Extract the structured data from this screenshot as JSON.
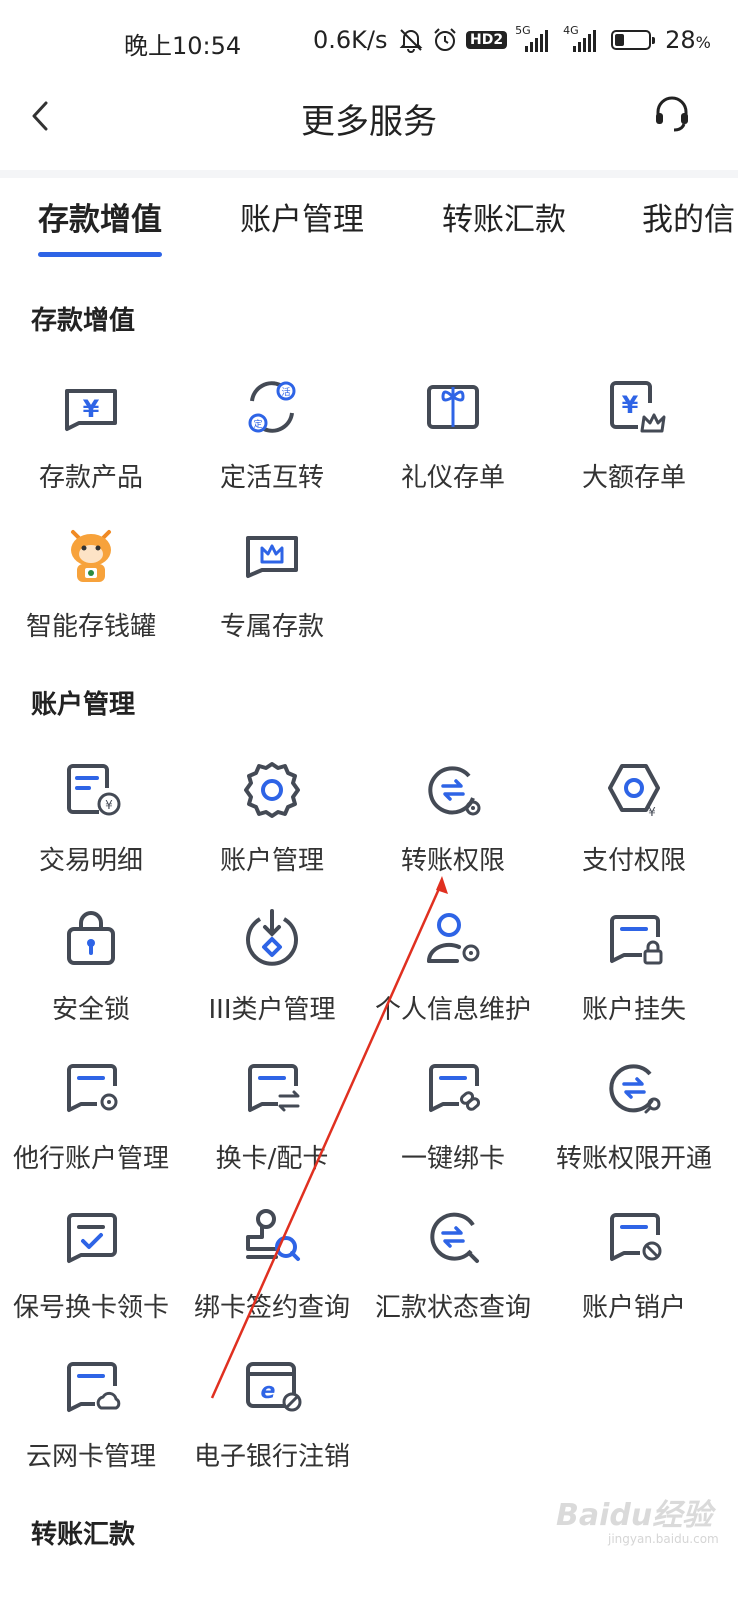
{
  "status": {
    "time": "晚上10:54",
    "speed": "0.6K/s",
    "hd": "HD2",
    "net1": "5G",
    "net2": "4G",
    "battery": "28",
    "battery_unit": "%",
    "battery_level": 0.28
  },
  "nav": {
    "title": "更多服务"
  },
  "tabs": [
    "存款增值",
    "账户管理",
    "转账汇款",
    "我的信"
  ],
  "colors": {
    "accent": "#2e64e6",
    "icon_dark": "#444a55",
    "annotation": "#e03020"
  },
  "sections": {
    "deposit": {
      "title": "存款增值",
      "items": [
        {
          "label": "存款产品",
          "icon": "yuan-card-icon"
        },
        {
          "label": "定活互转",
          "icon": "exchange-fixed-current-icon"
        },
        {
          "label": "礼仪存单",
          "icon": "gift-certificate-icon"
        },
        {
          "label": "大额存单",
          "icon": "large-deposit-icon"
        },
        {
          "label": "智能存钱罐",
          "icon": "piggy-bank-mascot-icon"
        },
        {
          "label": "专属存款",
          "icon": "crown-card-icon"
        }
      ]
    },
    "account": {
      "title": "账户管理",
      "items": [
        {
          "label": "交易明细",
          "icon": "transaction-detail-icon"
        },
        {
          "label": "账户管理",
          "icon": "gear-icon"
        },
        {
          "label": "转账权限",
          "icon": "transfer-permission-icon"
        },
        {
          "label": "支付权限",
          "icon": "payment-permission-icon"
        },
        {
          "label": "安全锁",
          "icon": "security-lock-icon"
        },
        {
          "label": "III类户管理",
          "icon": "class3-account-icon"
        },
        {
          "label": "个人信息维护",
          "icon": "user-settings-icon"
        },
        {
          "label": "账户挂失",
          "icon": "card-lock-icon"
        },
        {
          "label": "他行账户管理",
          "icon": "card-gear-icon"
        },
        {
          "label": "换卡/配卡",
          "icon": "card-swap-icon"
        },
        {
          "label": "一键绑卡",
          "icon": "card-link-icon"
        },
        {
          "label": "转账权限开通",
          "icon": "transfer-search-icon"
        },
        {
          "label": "保号换卡领卡",
          "icon": "card-check-icon"
        },
        {
          "label": "绑卡签约查询",
          "icon": "stamp-search-icon"
        },
        {
          "label": "汇款状态查询",
          "icon": "remittance-status-icon"
        },
        {
          "label": "账户销户",
          "icon": "card-cancel-icon"
        },
        {
          "label": "云网卡管理",
          "icon": "cloud-card-icon"
        },
        {
          "label": "电子银行注销",
          "icon": "ebank-cancel-icon"
        }
      ]
    },
    "transfer": {
      "title": "转账汇款"
    }
  },
  "watermark": {
    "main": "Baidu经验",
    "sub": "jingyan.baidu.com"
  }
}
